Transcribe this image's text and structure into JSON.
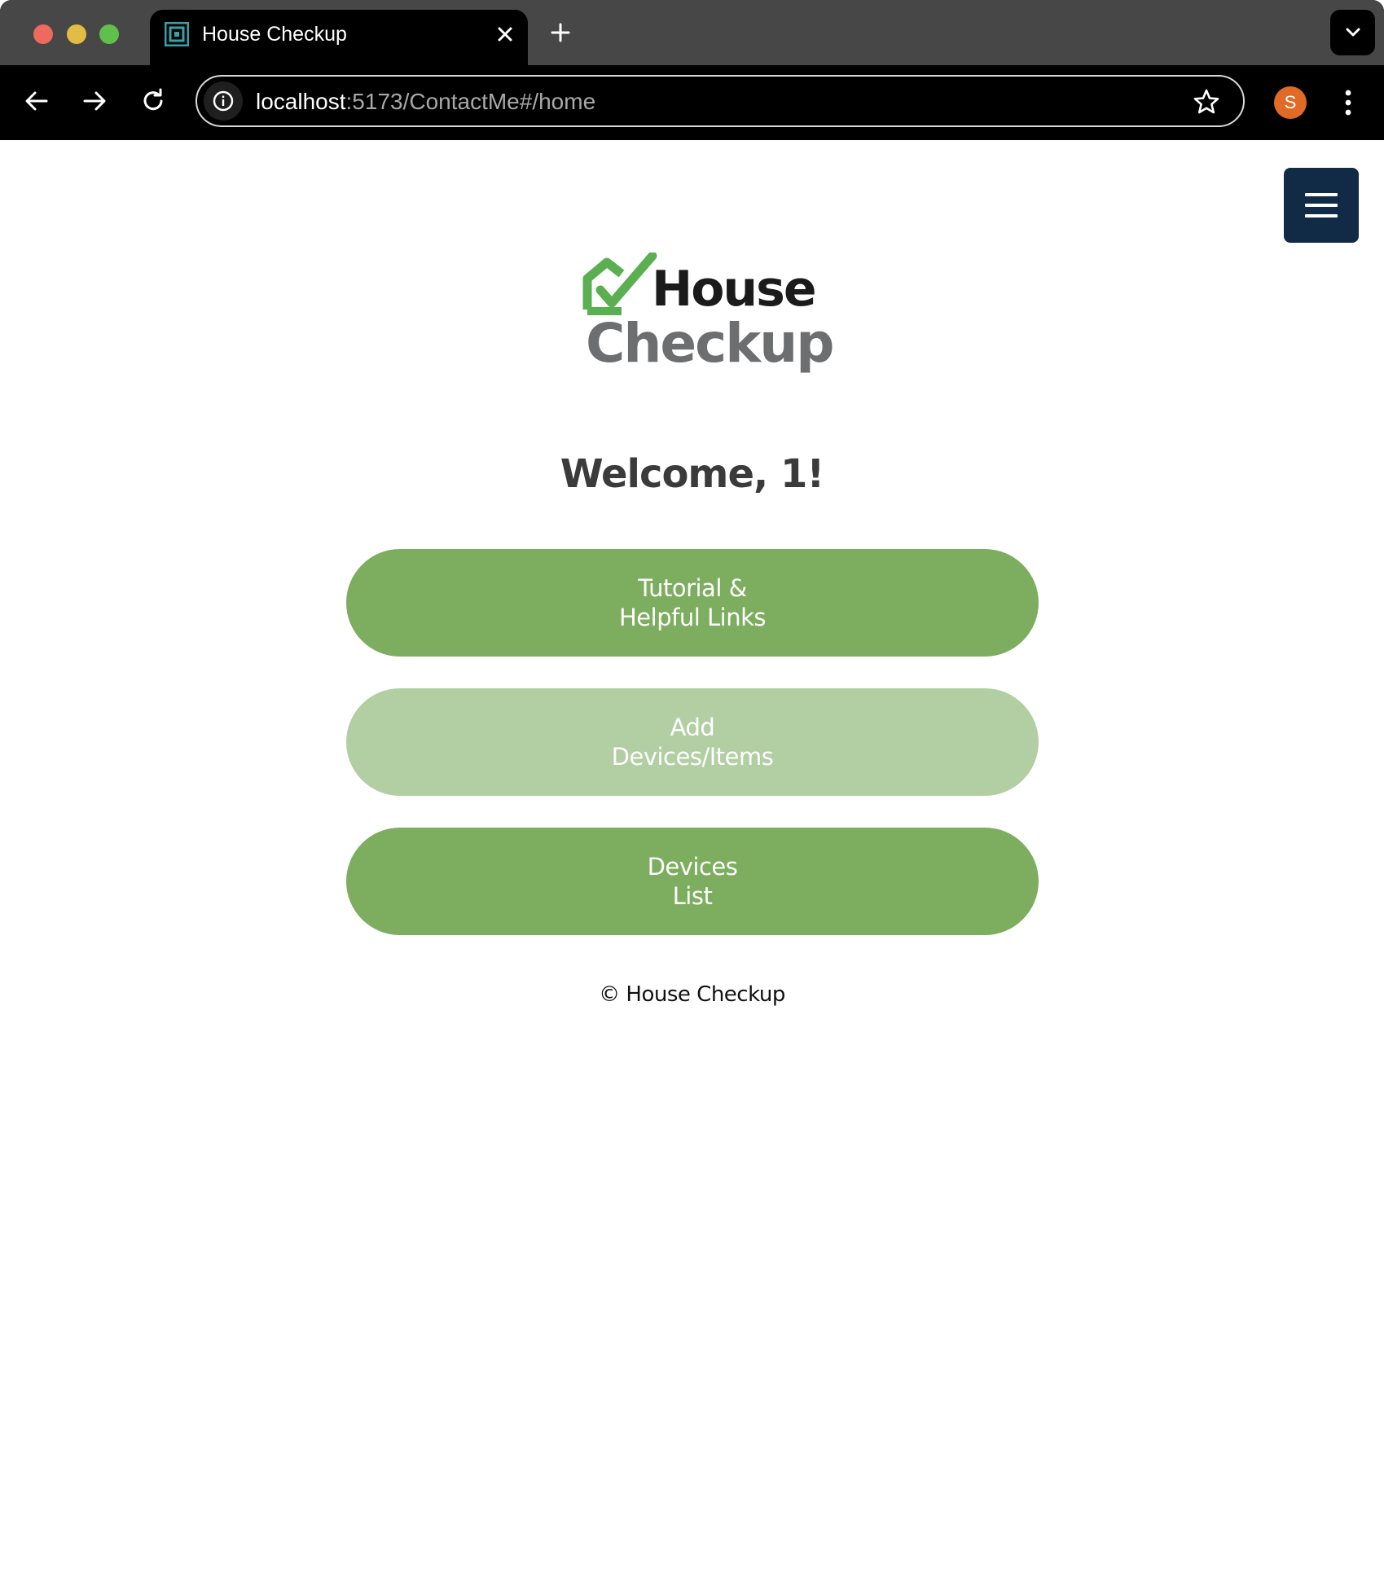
{
  "browser": {
    "tab_title": "House Checkup",
    "url_host": "localhost",
    "url_path": ":5173/ContactMe#/home",
    "profile_initial": "S",
    "profile_color": "#e06a26"
  },
  "page": {
    "menu_icon": "hamburger-icon",
    "logo": {
      "line1": "House",
      "line2": "Checkup",
      "check_color": "#5ab050"
    },
    "welcome": "Welcome, 1!",
    "buttons": [
      {
        "line1": "Tutorial &",
        "line2": "Helpful Links",
        "color": "#7dad5e"
      },
      {
        "line1": "Add",
        "line2": "Devices/Items",
        "color": "#b2cfa3"
      },
      {
        "line1": "Devices",
        "line2": "List",
        "color": "#7dad5e"
      }
    ],
    "footer": "© House Checkup"
  },
  "colors": {
    "menu_button": "#112a45",
    "heading": "#3b3b3b"
  }
}
